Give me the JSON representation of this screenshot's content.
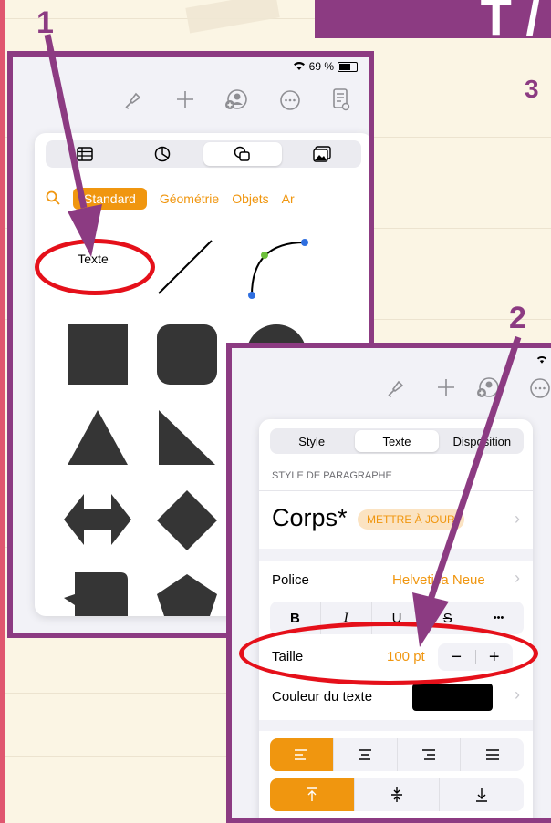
{
  "banner": {
    "text": "T /"
  },
  "steps": {
    "one": "1",
    "two": "2",
    "three": "3"
  },
  "panel1": {
    "status": {
      "battery": "69 %"
    },
    "toolbar": [
      "paintbrush-icon",
      "plus-icon",
      "collaborate-icon",
      "more-icon",
      "document-icon"
    ],
    "segments": [
      "table-icon",
      "chart-icon",
      "shapes-icon",
      "media-icon"
    ],
    "categories": {
      "active": "Standard",
      "items": [
        "Géométrie",
        "Objets",
        "Ar"
      ]
    },
    "text_shape_label": "Texte"
  },
  "panel2": {
    "tabs": [
      "Style",
      "Texte",
      "Disposition"
    ],
    "paragraph_style_header": "STYLE DE PARAGRAPHE",
    "paragraph_style_name": "Corps*",
    "update_button": "METTRE À JOUR",
    "font_label": "Police",
    "font_value": "Helvetica Neue",
    "format_buttons": [
      "B",
      "I",
      "U",
      "S",
      "•••"
    ],
    "size_label": "Taille",
    "size_value": "100 pt",
    "size_minus": "−",
    "size_plus": "+",
    "text_color_label": "Couleur du texte",
    "align_buttons": [
      "align-left-icon",
      "align-center-icon",
      "align-right-icon",
      "justify-icon"
    ],
    "valign_buttons": [
      "align-top-icon",
      "align-middle-icon",
      "align-bottom-icon"
    ]
  },
  "colors": {
    "accent": "#f0960f",
    "frame": "#8c3b82",
    "highlight": "#e5101a",
    "text_color_swatch": "#000000"
  }
}
